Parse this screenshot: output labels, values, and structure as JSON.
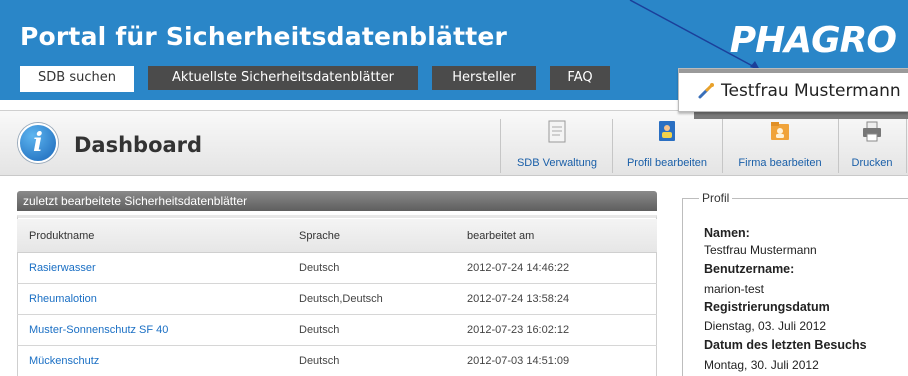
{
  "header": {
    "portal_title": "Portal für Sicherheitsdatenblätter",
    "logo": "PHAGRO",
    "colors": {
      "header_bg": "#2a86c8",
      "tab_bg": "#4b4b4b",
      "link": "#1a6fc4"
    }
  },
  "tabs": [
    {
      "label": "SDB suchen",
      "active": true
    },
    {
      "label": "Aktuellste Sicherheitsdatenblätter",
      "active": false
    },
    {
      "label": "Hersteller",
      "active": false
    },
    {
      "label": "FAQ",
      "active": false
    }
  ],
  "user_popup": {
    "icon": "wrench-icon",
    "name": "Testfrau Mustermann"
  },
  "dashboard": {
    "icon": "info-icon",
    "title": "Dashboard",
    "tools": [
      {
        "label": "SDB Verwaltung",
        "icon": "document-icon"
      },
      {
        "label": "Profil bearbeiten",
        "icon": "contact-card-icon"
      },
      {
        "label": "Firma bearbeiten",
        "icon": "folder-person-icon"
      },
      {
        "label": "Drucken",
        "icon": "printer-icon"
      }
    ]
  },
  "recent": {
    "panel_title": "zuletzt bearbeitete Sicherheitsdatenblätter",
    "columns": [
      "Produktname",
      "Sprache",
      "bearbeitet am"
    ],
    "rows": [
      {
        "product": "Rasierwasser",
        "language": "Deutsch",
        "edited": "2012-07-24 14:46:22"
      },
      {
        "product": "Rheumalotion",
        "language": "Deutsch,Deutsch",
        "edited": "2012-07-24 13:58:24"
      },
      {
        "product": "Muster-Sonnenschutz SF 40",
        "language": "Deutsch",
        "edited": "2012-07-23 16:02:12"
      },
      {
        "product": "Mückenschutz",
        "language": "Deutsch",
        "edited": "2012-07-03 14:51:09"
      }
    ]
  },
  "profile": {
    "legend": "Profil",
    "name_label": "Namen:",
    "name_value": "Testfrau Mustermann",
    "username_label": "Benutzername:",
    "username_value": "marion-test",
    "registered_label": "Registrierungsdatum",
    "registered_value": "Dienstag, 03. Juli 2012",
    "last_visit_label": "Datum des letzten Besuchs",
    "last_visit_value": "Montag, 30. Juli 2012"
  }
}
